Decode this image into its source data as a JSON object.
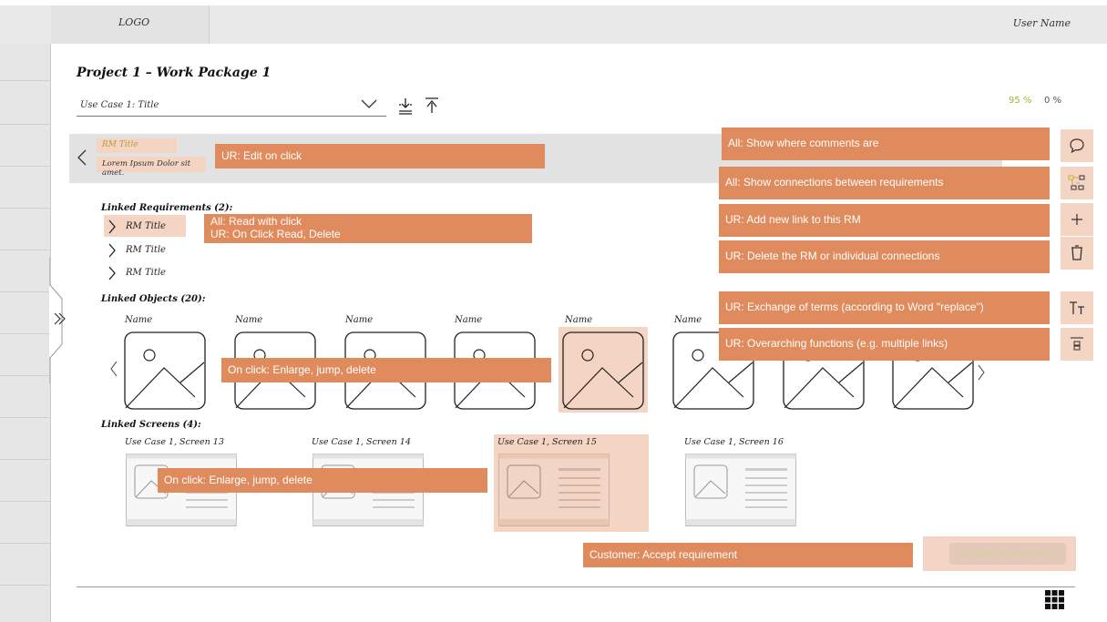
{
  "header": {
    "logo": "LOGO",
    "user_name": "User Name"
  },
  "project": {
    "title": "Project 1 – Work Package 1",
    "use_case_select": "Use Case 1: Title",
    "progress_a": "95 %",
    "progress_b": "0 %"
  },
  "rm": {
    "title": "RM Title",
    "description": "Lorem Ipsum Dolor sit amet."
  },
  "linked_requirements": {
    "heading": "Linked Requirements (2):",
    "items": [
      "RM Title",
      "RM Title",
      "RM Title"
    ]
  },
  "linked_objects": {
    "heading": "Linked Objects (20):",
    "names": [
      "Name",
      "Name",
      "Name",
      "Name",
      "Name",
      "Name"
    ]
  },
  "linked_screens": {
    "heading": "Linked Screens (4):",
    "items": [
      "Use Case 1, Screen 13",
      "Use Case 1, Screen 14",
      "Use Case 1, Screen 15",
      "Use Case 1, Screen 16"
    ]
  },
  "notes": {
    "edit_on_click": "UR: Edit on click",
    "read_with_click": "All: Read with click\nUR: On Click Read, Delete",
    "objects_click": "On click: Enlarge, jump, delete",
    "screens_click": "On click: Enlarge, jump, delete",
    "customer_accept": "Customer: Accept requirement",
    "show_comments": "All: Show where comments are",
    "show_connections": "All: Show connections between requirements",
    "add_link": "UR: Add new link to this RM",
    "delete_rm": "UR: Delete the RM or individual connections",
    "exchange_terms": "UR: Exchange of terms (according to Word \"replace\")",
    "overarching": "UR: Overarching functions (e.g. multiple links)"
  },
  "accept_button": "Accept Requirement",
  "colors": {
    "note": "#df8b5d",
    "highlight": "#f4d4c3",
    "accent_green": "#9bb832"
  }
}
